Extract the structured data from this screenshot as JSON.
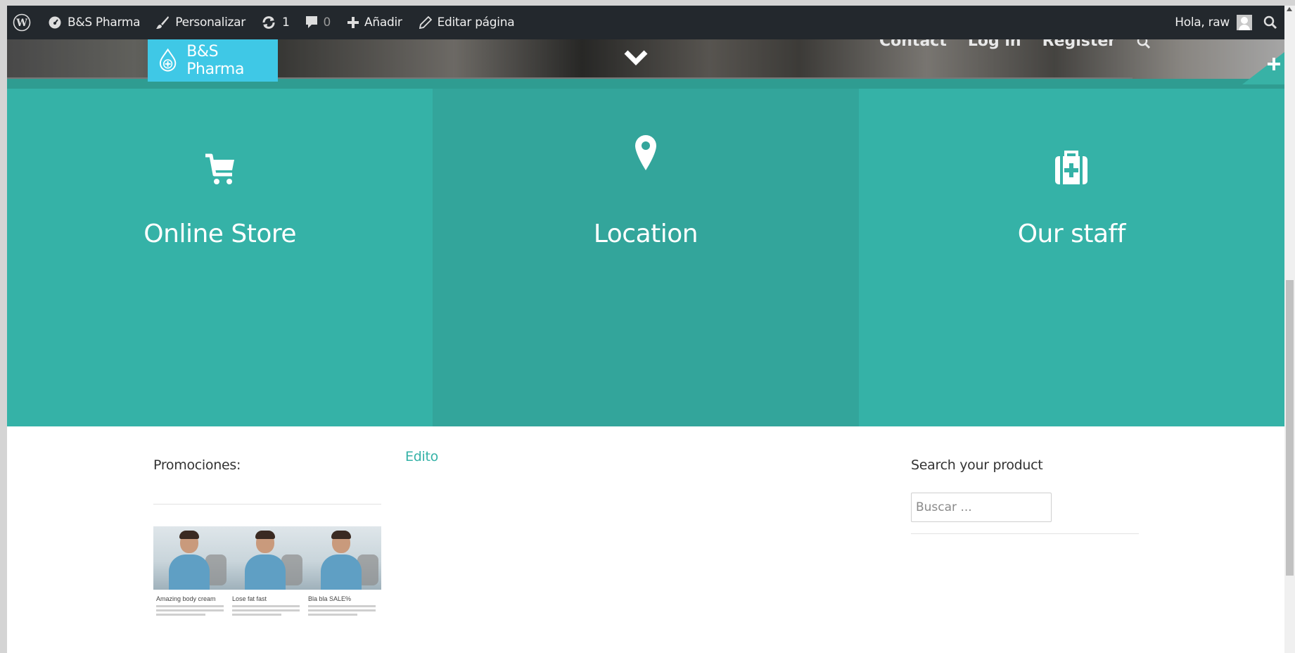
{
  "adminbar": {
    "site_name": "B&S Pharma",
    "customize_label": "Personalizar",
    "updates_count": "1",
    "comments_count": "0",
    "add_label": "Añadir",
    "edit_label": "Editar página",
    "greeting": "Hola, raw"
  },
  "header": {
    "logo_text": "B&S Pharma",
    "nav": [
      "Contact",
      "Log in",
      "Register"
    ]
  },
  "features": [
    {
      "title": "Online Store",
      "icon": "cart-icon"
    },
    {
      "title": "Location",
      "icon": "map-marker-icon"
    },
    {
      "title": "Our staff",
      "icon": "medkit-icon"
    }
  ],
  "content": {
    "promotions_title": "Promociones:",
    "edito_link": "Edito",
    "search_title": "Search your product",
    "search_placeholder": "Buscar ...",
    "promo_items": [
      {
        "name": "Amazing body cream"
      },
      {
        "name": "Lose fat fast"
      },
      {
        "name": "Bla bla SALE%"
      }
    ]
  },
  "colors": {
    "teal": "#35b2a7",
    "teal_dark": "#33a59b",
    "logo_blue": "#3fc8e6",
    "adminbar_bg": "#23282d"
  }
}
